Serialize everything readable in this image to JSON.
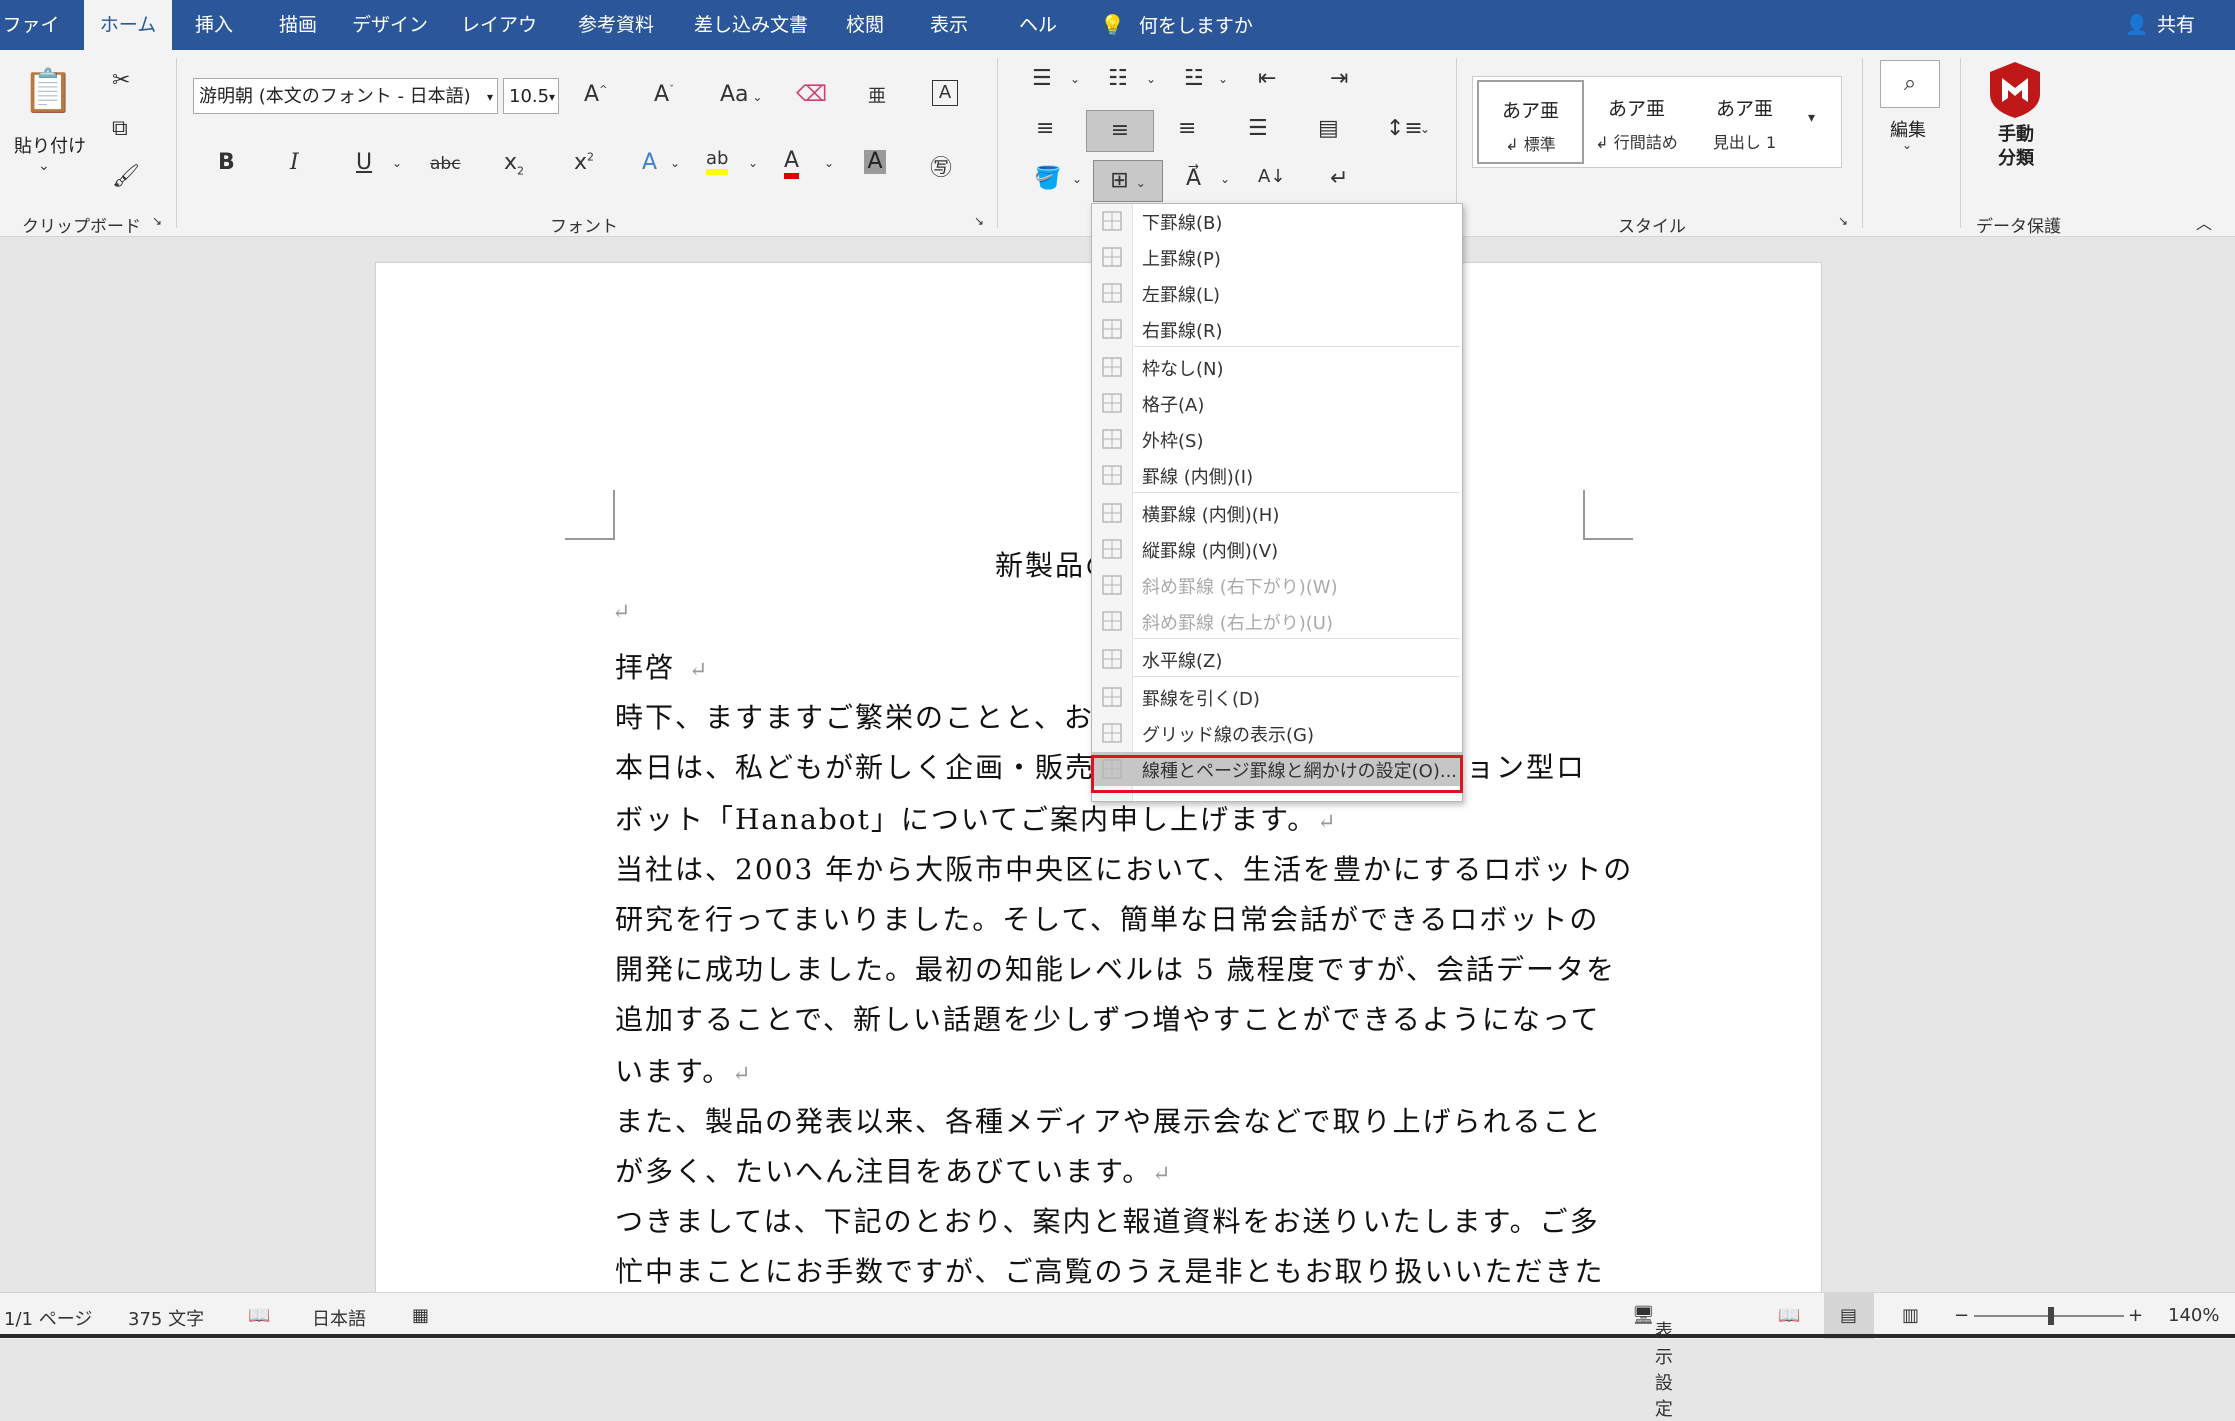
{
  "menubar": {
    "tabs": [
      {
        "label": "ファイル",
        "active": false
      },
      {
        "label": "ホーム",
        "active": true
      },
      {
        "label": "挿入",
        "active": false
      },
      {
        "label": "描画",
        "active": false
      },
      {
        "label": "デザイン",
        "active": false
      },
      {
        "label": "レイアウト",
        "active": false
      },
      {
        "label": "参考資料",
        "active": false
      },
      {
        "label": "差し込み文書",
        "active": false
      },
      {
        "label": "校閲",
        "active": false
      },
      {
        "label": "表示",
        "active": false
      },
      {
        "label": "ヘルプ",
        "active": false
      }
    ],
    "tell_me": "何をしますか",
    "share": "共有"
  },
  "ribbon": {
    "clipboard": {
      "paste_label": "貼り付け",
      "group_label": "クリップボード"
    },
    "font": {
      "name": "游明朝 (本文のフォント - 日本語)",
      "size": "10.5",
      "group_label": "フォント",
      "change_case": "Aa"
    },
    "styles": {
      "items": [
        {
          "preview": "あア亜",
          "name": "↲ 標準"
        },
        {
          "preview": "あア亜",
          "name": "↲ 行間詰め"
        },
        {
          "preview": "あア亜",
          "name": "見出し 1"
        }
      ],
      "group_label": "スタイル"
    },
    "editing": {
      "label": "編集"
    },
    "protect": {
      "button_label_1": "手動",
      "button_label_2": "分類",
      "group_label": "データ保護"
    }
  },
  "document": {
    "title": "新製品の",
    "greeting": "拝啓",
    "lines": [
      "時下、ますますご繁栄のことと、お",
      "本日は、私どもが新しく企画・販売",
      "ボット「Hanabot」についてご案内申し上げます。",
      "当社は、2003 年から大阪市中央区において、生活を豊かにするロボットの",
      "研究を行ってまいりました。そして、簡単な日常会話ができるロボットの",
      "開発に成功しました。最初の知能レベルは 5 歳程度ですが、会話データを",
      "追加することで、新しい話題を少しずつ増やすことができるようになって",
      "います。",
      "また、製品の発表以来、各種メディアや展示会などで取り上げられること",
      "が多く、たいへん注目をあびています。",
      "つきましては、下記のとおり、案内と報道資料をお送りいたします。ご多",
      "忙中まことにお手数ですが、ご高覧のうえ是非ともお取り扱いいただきた"
    ],
    "line2_tail": "ョン型ロ"
  },
  "border_menu": {
    "items": [
      {
        "label": "下罫線(B)",
        "icon": "border-bottom-icon",
        "disabled": false
      },
      {
        "label": "上罫線(P)",
        "icon": "border-top-icon",
        "disabled": false
      },
      {
        "label": "左罫線(L)",
        "icon": "border-left-icon",
        "disabled": false
      },
      {
        "label": "右罫線(R)",
        "icon": "border-right-icon",
        "disabled": false
      },
      {
        "label": "枠なし(N)",
        "icon": "no-border-icon",
        "disabled": false
      },
      {
        "label": "格子(A)",
        "icon": "all-borders-icon",
        "disabled": false
      },
      {
        "label": "外枠(S)",
        "icon": "outside-borders-icon",
        "disabled": false
      },
      {
        "label": "罫線 (内側)(I)",
        "icon": "inside-borders-icon",
        "disabled": false
      },
      {
        "label": "横罫線 (内側)(H)",
        "icon": "inside-horizontal-border-icon",
        "disabled": false
      },
      {
        "label": "縦罫線 (内側)(V)",
        "icon": "inside-vertical-border-icon",
        "disabled": false
      },
      {
        "label": "斜め罫線 (右下がり)(W)",
        "icon": "diagonal-down-border-icon",
        "disabled": true
      },
      {
        "label": "斜め罫線 (右上がり)(U)",
        "icon": "diagonal-up-border-icon",
        "disabled": true
      },
      {
        "label": "水平線(Z)",
        "icon": "horizontal-line-icon",
        "disabled": false
      },
      {
        "label": "罫線を引く(D)",
        "icon": "draw-table-icon",
        "disabled": false
      },
      {
        "label": "グリッド線の表示(G)",
        "icon": "view-gridlines-icon",
        "disabled": false
      },
      {
        "label": "線種とページ罫線と網かけの設定(O)...",
        "icon": "borders-shading-icon",
        "disabled": false,
        "highlight": true
      }
    ]
  },
  "statusbar": {
    "page": "1/1 ページ",
    "words": "375 文字",
    "language": "日本語",
    "display_settings": "表示設定",
    "zoom": "140%"
  },
  "colors": {
    "accent": "#2b579a",
    "highlight_box": "#e0121f",
    "highlight_yellow": "#ffff00",
    "font_red": "#e00000"
  }
}
